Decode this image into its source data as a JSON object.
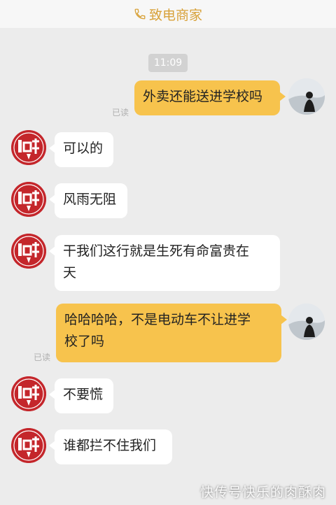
{
  "header": {
    "title": "致电商家",
    "phone_icon": "phone-icon",
    "color": "#d8a23a"
  },
  "time": "11:09",
  "status": {
    "read_label": "已读"
  },
  "messages": [
    {
      "from": "user",
      "text": "外卖还能送进学校吗"
    },
    {
      "from": "merchant",
      "text": "可以的"
    },
    {
      "from": "merchant",
      "text": "风雨无阻"
    },
    {
      "from": "merchant",
      "line1": "干我们这行就是生死有命富贵在",
      "line2": "天"
    },
    {
      "from": "user",
      "line1": "哈哈哈哈，不是电动车不让进学",
      "line2": "校了吗"
    },
    {
      "from": "merchant",
      "text": "不要慌"
    },
    {
      "from": "merchant",
      "text": "谁都拦不住我们"
    }
  ],
  "merchant_avatar": {
    "icon": "merchant-logo-icon",
    "color": "#c4262b"
  },
  "user_avatar": {
    "icon": "user-avatar-icon"
  },
  "watermark": "快传号快乐的肉酥肉",
  "colors": {
    "user_bubble": "#f7c34d",
    "merchant_bubble": "#ffffff",
    "background": "#ececec"
  }
}
